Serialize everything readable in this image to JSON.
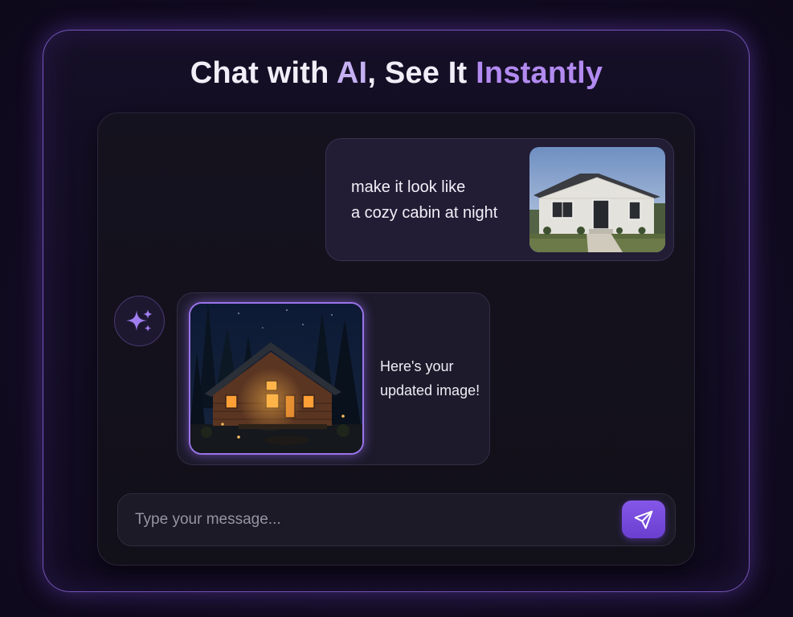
{
  "headline": {
    "part1": "Chat with ",
    "accent1": "AI",
    "part2": ", See It ",
    "accent2": "Instantly"
  },
  "conversation": {
    "user_message": {
      "line1": "make it look like",
      "line2": "a cozy cabin at night",
      "image": "house-daytime-photo"
    },
    "ai_message": {
      "avatar_icon": "sparkles-icon",
      "image": "cozy-cabin-night-photo",
      "line1": "Here's your",
      "line2": "updated image!"
    }
  },
  "composer": {
    "placeholder": "Type your message...",
    "send_icon": "paper-plane-icon"
  },
  "colors": {
    "accent": "#7c4dde",
    "accent_light": "#b28af0",
    "background": "#120c22"
  }
}
